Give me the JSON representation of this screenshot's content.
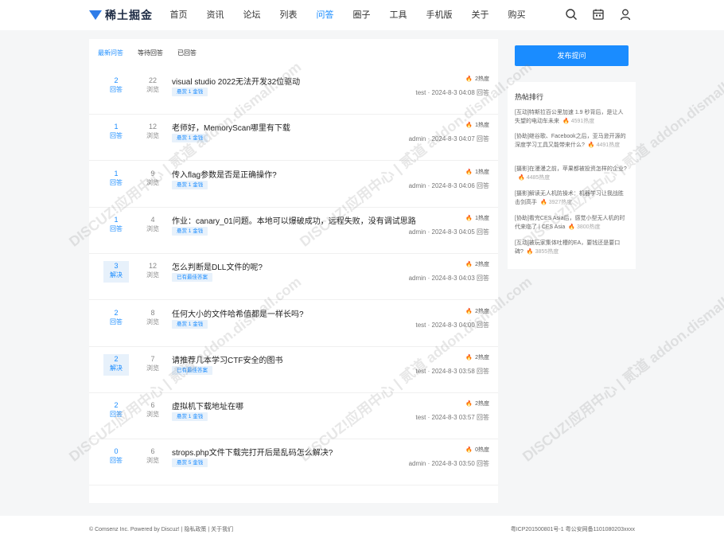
{
  "brand": {
    "name": "稀土掘金"
  },
  "nav": [
    "首页",
    "资讯",
    "论坛",
    "列表",
    "问答",
    "圈子",
    "工具",
    "手机版",
    "关于",
    "购买"
  ],
  "nav_active_index": 4,
  "top_icons": [
    "search-icon",
    "calendar-icon",
    "user-icon"
  ],
  "tabs": [
    "最新问答",
    "等待回答",
    "已回答"
  ],
  "answers_label": "回答",
  "solved_label": "解决",
  "views_label": "浏览",
  "questions": [
    {
      "answers": "2",
      "solved": false,
      "views": "22",
      "title": "visual studio 2022无法开发32位驱动",
      "badge": "悬赏 1 金钱",
      "heat": "2热度",
      "author": "test",
      "time": "2024-8-3 04:08",
      "action": "回答"
    },
    {
      "answers": "1",
      "solved": false,
      "views": "12",
      "title": "老师好，MemoryScan哪里有下载",
      "badge": "悬赏 1 金钱",
      "heat": "1热度",
      "author": "admin",
      "time": "2024-8-3 04:07",
      "action": "回答"
    },
    {
      "answers": "1",
      "solved": false,
      "views": "9",
      "title": "传入flag参数是否是正确操作?",
      "badge": "悬赏 1 金钱",
      "heat": "1热度",
      "author": "admin",
      "time": "2024-8-3 04:06",
      "action": "回答"
    },
    {
      "answers": "1",
      "solved": false,
      "views": "4",
      "title": "作业：canary_01问题。本地可以爆破成功，远程失败，没有调试思路",
      "badge": "悬赏 1 金钱",
      "heat": "1热度",
      "author": "admin",
      "time": "2024-8-3 04:05",
      "action": "回答"
    },
    {
      "answers": "3",
      "solved": true,
      "views": "12",
      "title": "怎么判断是DLL文件的呢?",
      "badge": "已有最佳答案",
      "heat": "2热度",
      "author": "admin",
      "time": "2024-8-3 04:03",
      "action": "回答"
    },
    {
      "answers": "2",
      "solved": false,
      "views": "8",
      "title": "任何大小的文件哈希值都是一样长吗?",
      "badge": "悬赏 1 金钱",
      "heat": "2热度",
      "author": "test",
      "time": "2024-8-3 04:00",
      "action": "回答"
    },
    {
      "answers": "2",
      "solved": true,
      "views": "7",
      "title": "请推荐几本学习CTF安全的图书",
      "badge": "已有最佳答案",
      "heat": "2热度",
      "author": "test",
      "time": "2024-8-3 03:58",
      "action": "回答"
    },
    {
      "answers": "2",
      "solved": false,
      "views": "6",
      "title": "虚拟机下载地址在哪",
      "badge": "悬赏 1 金钱",
      "heat": "2热度",
      "author": "test",
      "time": "2024-8-3 03:57",
      "action": "回答"
    },
    {
      "answers": "0",
      "solved": false,
      "views": "6",
      "title": "strops.php文件下载完打开后是乱码怎么解决?",
      "badge": "悬赏 5 金钱",
      "heat": "0热度",
      "author": "admin",
      "time": "2024-8-3 03:50",
      "action": "回答"
    }
  ],
  "ask_button": "发布提问",
  "hot": {
    "title": "热帖排行",
    "items": [
      {
        "text": "[互动]特斯拉百公里加速 1.9 秒背后，是让人失望的电动车未来",
        "heat": "4591热度"
      },
      {
        "text": "[协助]继谷歌、Facebook之后，亚马逊开源的深度学习工具又能带来什么?",
        "heat": "4491热度"
      },
      {
        "text": "[摄影]在漫漫之前，苹果都被投资怎样的企业?",
        "heat": "4485热度"
      },
      {
        "text": "[摄影]解读无人机防操术：机器学习让我战胜击剑高手",
        "heat": "3927热度"
      },
      {
        "text": "[协助]看完CES Asia后，感觉小型无人机的时代来临了 | CES Asia",
        "heat": "3800热度"
      },
      {
        "text": "[互动]被玩家集体吐槽的EA，要钱还是要口碑?",
        "heat": "3855热度"
      }
    ]
  },
  "footer": {
    "left": "© Comsenz Inc. Powered by Discuz!  |  隐私政策  |  关于我们",
    "right": "粤ICP201500801号-1    粤公安网备1101080203xxxx"
  },
  "watermark": "DISCUZ!应用中心 | 贰道 addon.dismall.com"
}
